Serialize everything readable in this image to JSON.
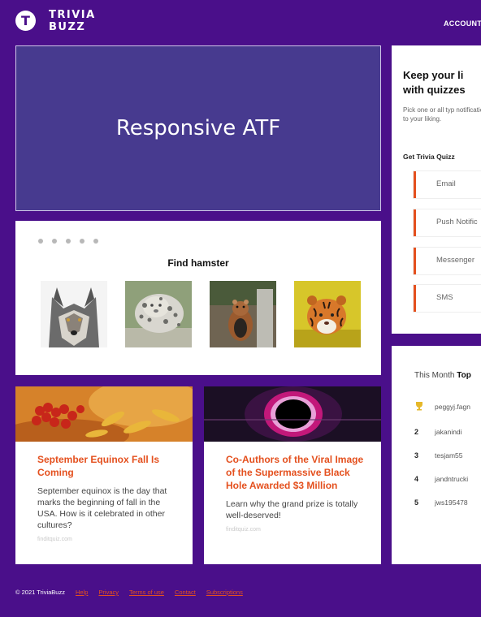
{
  "brand": {
    "logo_letter": "T",
    "name_line1": "TRIVIA",
    "name_line2": "BUZZ"
  },
  "nav": {
    "account": "ACCOUNT"
  },
  "hero": {
    "title": "Responsive ATF"
  },
  "quiz": {
    "dots": 5,
    "question": "Find hamster",
    "choices": [
      "wolf",
      "snow leopard",
      "hamster",
      "tiger cub"
    ]
  },
  "articles": [
    {
      "title": "September Equinox Fall Is Coming",
      "desc": "September equinox is the day that marks the beginning of fall in the USA. How is it celebrated in other cultures?",
      "source": "finditquiz.com"
    },
    {
      "title": "Co-Authors of the Viral Image of the Supermassive Black Hole Awarded $3 Million",
      "desc": "Learn why the grand prize is totally well-deserved!",
      "source": "finditquiz.com"
    }
  ],
  "sidebar": {
    "heading_line1": "Keep your li",
    "heading_line2": "with quizzes",
    "paragraph": "Pick one or all typ notifications and to your liking.",
    "get_label": "Get Trivia Quizz",
    "options": [
      "Email",
      "Push Notific",
      "Messenger",
      "SMS"
    ]
  },
  "leaderboard": {
    "heading_prefix": "This Month ",
    "heading_bold": "Top",
    "rows": [
      {
        "rank": "",
        "name": "peggyj.fagn"
      },
      {
        "rank": "2",
        "name": "jakanindi"
      },
      {
        "rank": "3",
        "name": "tesjam55"
      },
      {
        "rank": "4",
        "name": "jandntrucki"
      },
      {
        "rank": "5",
        "name": "jws195478"
      }
    ]
  },
  "footer": {
    "copyright": "© 2021 TriviaBuzz",
    "links": [
      "Help",
      "Privacy",
      "Terms of use",
      "Contact",
      "Subscriptions"
    ]
  },
  "colors": {
    "background": "#4a0f8a",
    "hero": "#473a8f",
    "accent": "#e4501e"
  }
}
